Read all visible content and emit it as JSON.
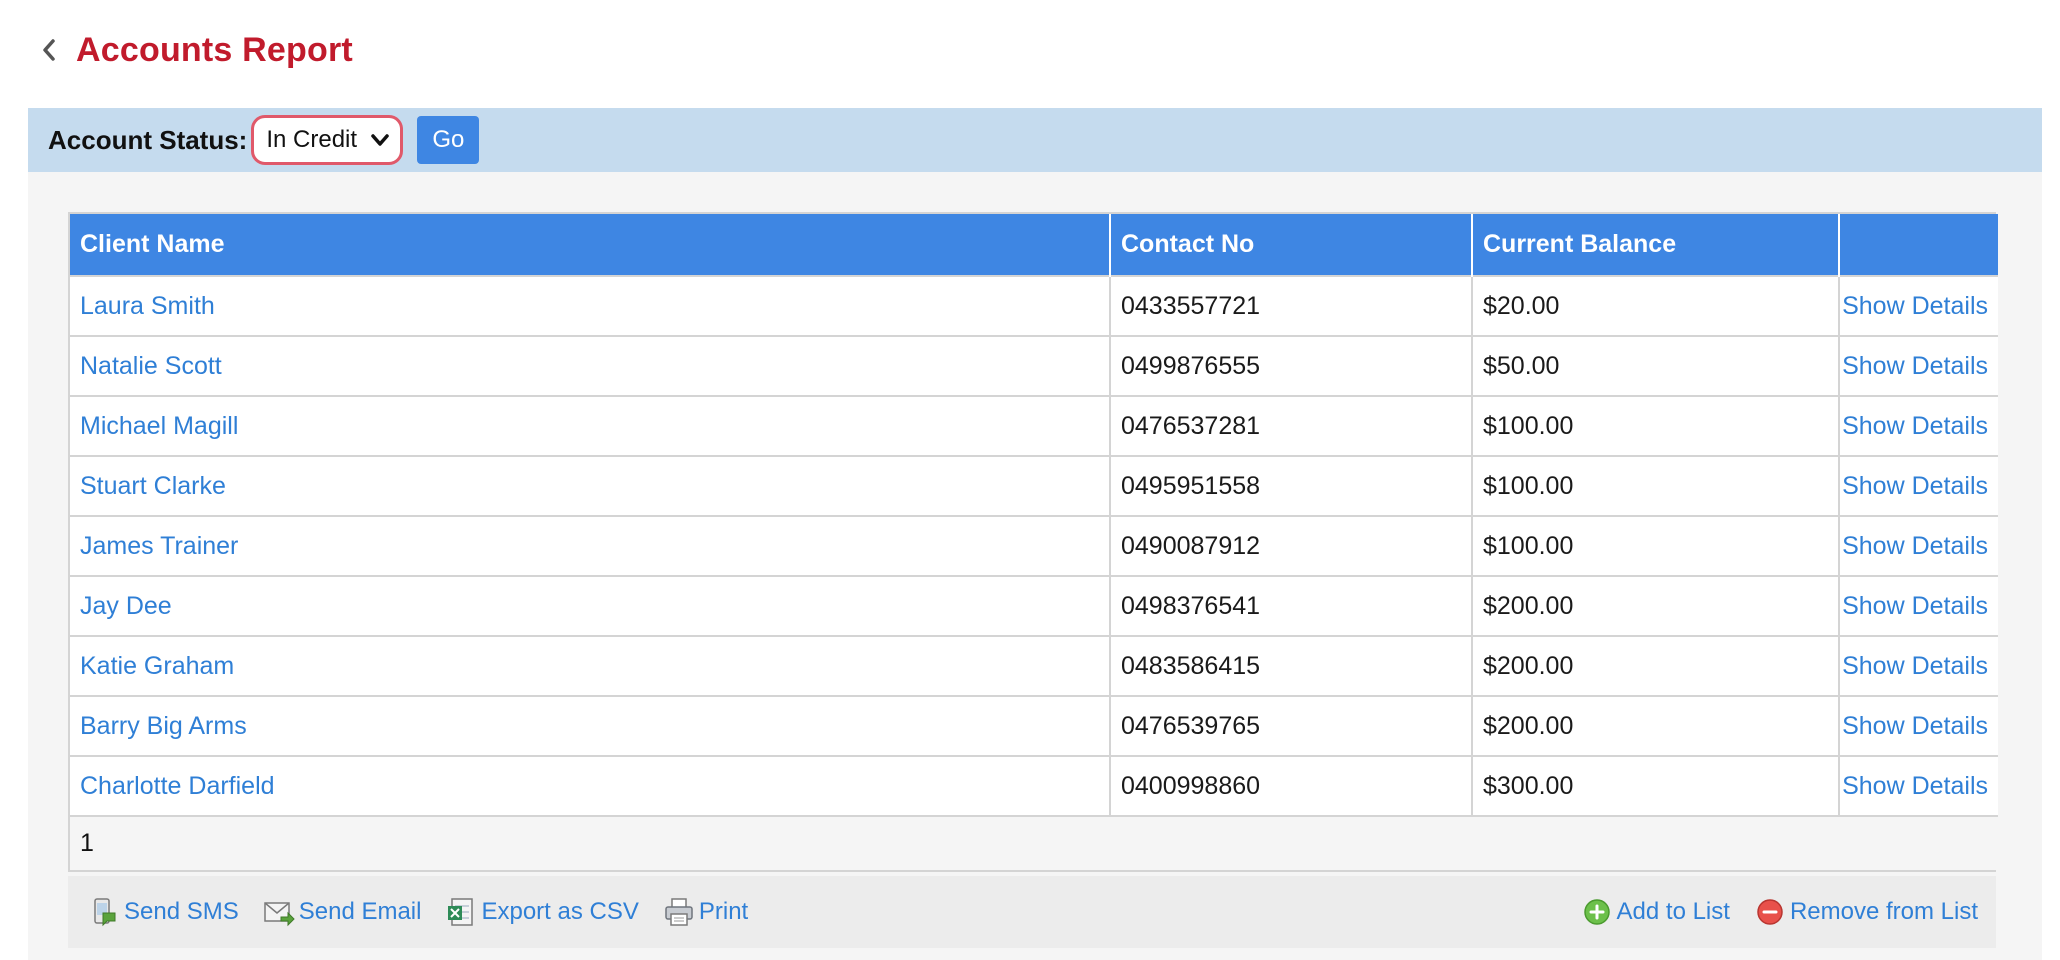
{
  "header": {
    "title": "Accounts Report"
  },
  "filter": {
    "label": "Account Status:",
    "selected": "In Credit",
    "go_label": "Go"
  },
  "table": {
    "columns": [
      "Client Name",
      "Contact No",
      "Current Balance",
      ""
    ],
    "rows": [
      {
        "name": "Laura Smith",
        "contact": "0433557721",
        "balance": "$20.00",
        "action": "Show Details"
      },
      {
        "name": "Natalie Scott",
        "contact": "0499876555",
        "balance": "$50.00",
        "action": "Show Details"
      },
      {
        "name": "Michael Magill",
        "contact": "0476537281",
        "balance": "$100.00",
        "action": "Show Details"
      },
      {
        "name": "Stuart Clarke",
        "contact": "0495951558",
        "balance": "$100.00",
        "action": "Show Details"
      },
      {
        "name": "James Trainer",
        "contact": "0490087912",
        "balance": "$100.00",
        "action": "Show Details"
      },
      {
        "name": "Jay Dee",
        "contact": "0498376541",
        "balance": "$200.00",
        "action": "Show Details"
      },
      {
        "name": "Katie Graham",
        "contact": "0483586415",
        "balance": "$200.00",
        "action": "Show Details"
      },
      {
        "name": "Barry Big Arms",
        "contact": "0476539765",
        "balance": "$200.00",
        "action": "Show Details"
      },
      {
        "name": "Charlotte Darfield",
        "contact": "0400998860",
        "balance": "$300.00",
        "action": "Show Details"
      }
    ],
    "pager": "1"
  },
  "footer": {
    "send_sms": "Send SMS",
    "send_email": "Send Email",
    "export_csv": "Export as CSV",
    "print": "Print",
    "add_to_list": "Add to List",
    "remove_from_list": "Remove from List"
  },
  "colors": {
    "title": "#c11b2c",
    "accent": "#3e86e3",
    "link": "#2f7fd6",
    "filter_bar": "#c5dbee",
    "select_border": "#e0596a"
  }
}
